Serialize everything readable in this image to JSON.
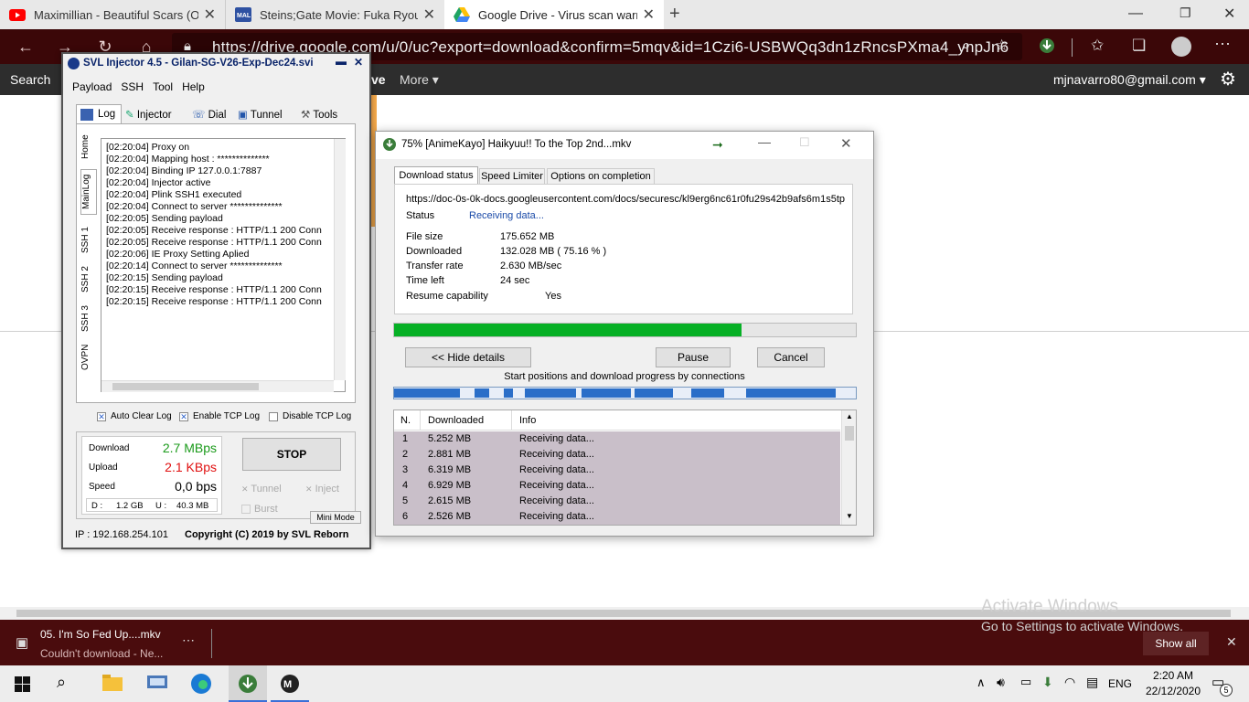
{
  "tabs": [
    {
      "title": "Maximillian - Beautiful Scars (Of",
      "icon": "youtube-icon",
      "color": "#ff0000"
    },
    {
      "title": "Steins;Gate Movie: Fuka Ryouiki",
      "icon": "mal-icon",
      "color": "#2e51a2"
    },
    {
      "title": "Google Drive - Virus scan warnin",
      "icon": "google-drive-icon",
      "color": "#1fa463"
    }
  ],
  "browser": {
    "url": "https://drive.google.com/u/0/uc?export=download&confirm=5mqv&id=1Czi6-USBWQq3dn1zRncsPXma4_ynpJn6"
  },
  "drive_bar": {
    "search": "Search",
    "drive_fragment": "ve",
    "more": "More",
    "account": "mjnavarro80@gmail.com"
  },
  "svl": {
    "title": "SVL Injector 4.5 - Gilan-SG-V26-Exp-Dec24.svi",
    "menu": [
      "Payload",
      "SSH",
      "Tool",
      "Help"
    ],
    "tabs": [
      "Log",
      "Injector",
      "Dial",
      "Tunnel",
      "Tools"
    ],
    "side_tabs": [
      "Home",
      "MainLog",
      "SSH 1",
      "SSH 2",
      "SSH 3",
      "OVPN"
    ],
    "log": [
      "[02:20:04] Proxy on",
      "[02:20:04] Mapping host : **************",
      "[02:20:04] Binding IP 127.0.0.1:7887",
      "[02:20:04] Injector active",
      "[02:20:04] Plink SSH1 executed",
      "[02:20:04] Connect to server **************",
      "[02:20:05] Sending payload",
      "[02:20:05] Receive response : HTTP/1.1 200 Conn",
      "[02:20:05] Receive response : HTTP/1.1 200 Conn",
      "[02:20:06] IE Proxy Setting Aplied",
      "[02:20:14] Connect to server **************",
      "[02:20:15] Sending payload",
      "[02:20:15] Receive response : HTTP/1.1 200 Conn",
      "[02:20:15] Receive response : HTTP/1.1 200 Conn"
    ],
    "checks": [
      "Auto Clear Log",
      "Enable TCP Log",
      "Disable TCP Log"
    ],
    "stats": {
      "download_label": "Download",
      "download": "2.7 MBps",
      "upload_label": "Upload",
      "upload": "2.1 KBps",
      "speed_label": "Speed",
      "speed": "0,0 bps",
      "d_label": "D :",
      "d": "1.2 GB",
      "u_label": "U :",
      "u": "40.3 MB"
    },
    "stop": "STOP",
    "opts": [
      "Tunnel",
      "Inject",
      "Burst"
    ],
    "mini": "Mini Mode",
    "ip": "IP : 192.168.254.101",
    "copyright": "Copyright (C) 2019 by SVL Reborn"
  },
  "idm": {
    "title": "75% [AnimeKayo] Haikyuu!! To the Top 2nd...mkv",
    "tabs": [
      "Download status",
      "Speed Limiter",
      "Options on completion"
    ],
    "url": "https://doc-0s-0k-docs.googleusercontent.com/docs/securesc/kl9erg6nc61r0fu29s42b9afs6m1s5tp",
    "status_label": "Status",
    "status": "Receiving data...",
    "fields": [
      {
        "label": "File size",
        "value": "175.652  MB"
      },
      {
        "label": "Downloaded",
        "value": "132.028  MB  ( 75.16 % )"
      },
      {
        "label": "Transfer rate",
        "value": "2.630  MB/sec"
      },
      {
        "label": "Time left",
        "value": "24 sec"
      },
      {
        "label": "Resume capability",
        "value": "Yes"
      }
    ],
    "progress": 0.7516,
    "hide_btn": "<< Hide details",
    "pause_btn": "Pause",
    "cancel_btn": "Cancel",
    "conn_caption": "Start positions and download progress by connections",
    "columns": [
      "N.",
      "Downloaded",
      "Info"
    ],
    "rows": [
      [
        "1",
        "5.252  MB",
        "Receiving data..."
      ],
      [
        "2",
        "2.881  MB",
        "Receiving data..."
      ],
      [
        "3",
        "6.319  MB",
        "Receiving data..."
      ],
      [
        "4",
        "6.929  MB",
        "Receiving data..."
      ],
      [
        "5",
        "2.615  MB",
        "Receiving data..."
      ],
      [
        "6",
        "2.526  MB",
        "Receiving data..."
      ]
    ]
  },
  "download_shelf": {
    "file": "05. I'm So Fed Up....mkv",
    "status": "Couldn't download - Ne...",
    "show_all": "Show all",
    "watermark_title": "Activate Windows",
    "watermark_sub": "Go to Settings to activate Windows."
  },
  "taskbar": {
    "lang": "ENG",
    "time": "2:20 AM",
    "date": "22/12/2020",
    "notif_count": "5"
  }
}
